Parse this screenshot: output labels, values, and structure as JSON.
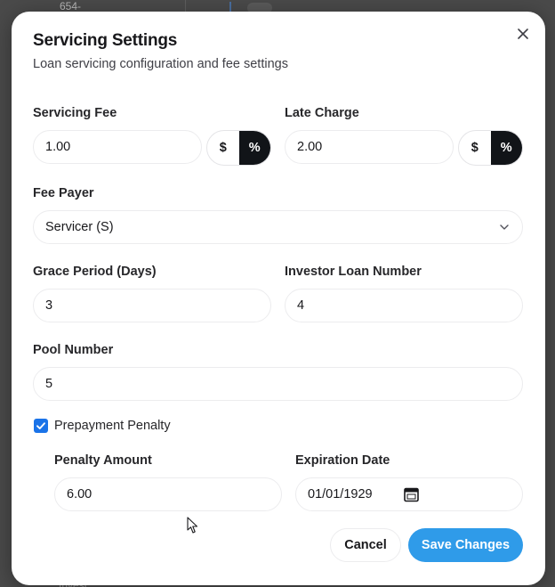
{
  "background": {
    "top_text": "654-",
    "bottom_text": "Invest"
  },
  "dialog": {
    "title": "Servicing Settings",
    "subtitle": "Loan servicing configuration and fee settings",
    "close_icon": "close-icon"
  },
  "fields": {
    "servicing_fee": {
      "label": "Servicing Fee",
      "value": "1.00",
      "unit_options": [
        "$",
        "%"
      ],
      "selected_unit": "%"
    },
    "late_charge": {
      "label": "Late Charge",
      "value": "2.00",
      "unit_options": [
        "$",
        "%"
      ],
      "selected_unit": "%"
    },
    "fee_payer": {
      "label": "Fee Payer",
      "value": "Servicer (S)"
    },
    "grace_period": {
      "label": "Grace Period (Days)",
      "value": "3"
    },
    "investor_loan_number": {
      "label": "Investor Loan Number",
      "value": "4"
    },
    "pool_number": {
      "label": "Pool Number",
      "value": "5"
    },
    "prepayment_penalty": {
      "label": "Prepayment Penalty",
      "checked": true
    },
    "penalty_amount": {
      "label": "Penalty Amount",
      "value": "6.00"
    },
    "expiration_date": {
      "label": "Expiration Date",
      "value": "01/01/1929",
      "icon": "calendar-icon"
    }
  },
  "actions": {
    "cancel_label": "Cancel",
    "save_label": "Save Changes"
  },
  "colors": {
    "accent": "#2f9be9",
    "toggle_active": "#111418",
    "checkbox": "#1a73e8"
  }
}
